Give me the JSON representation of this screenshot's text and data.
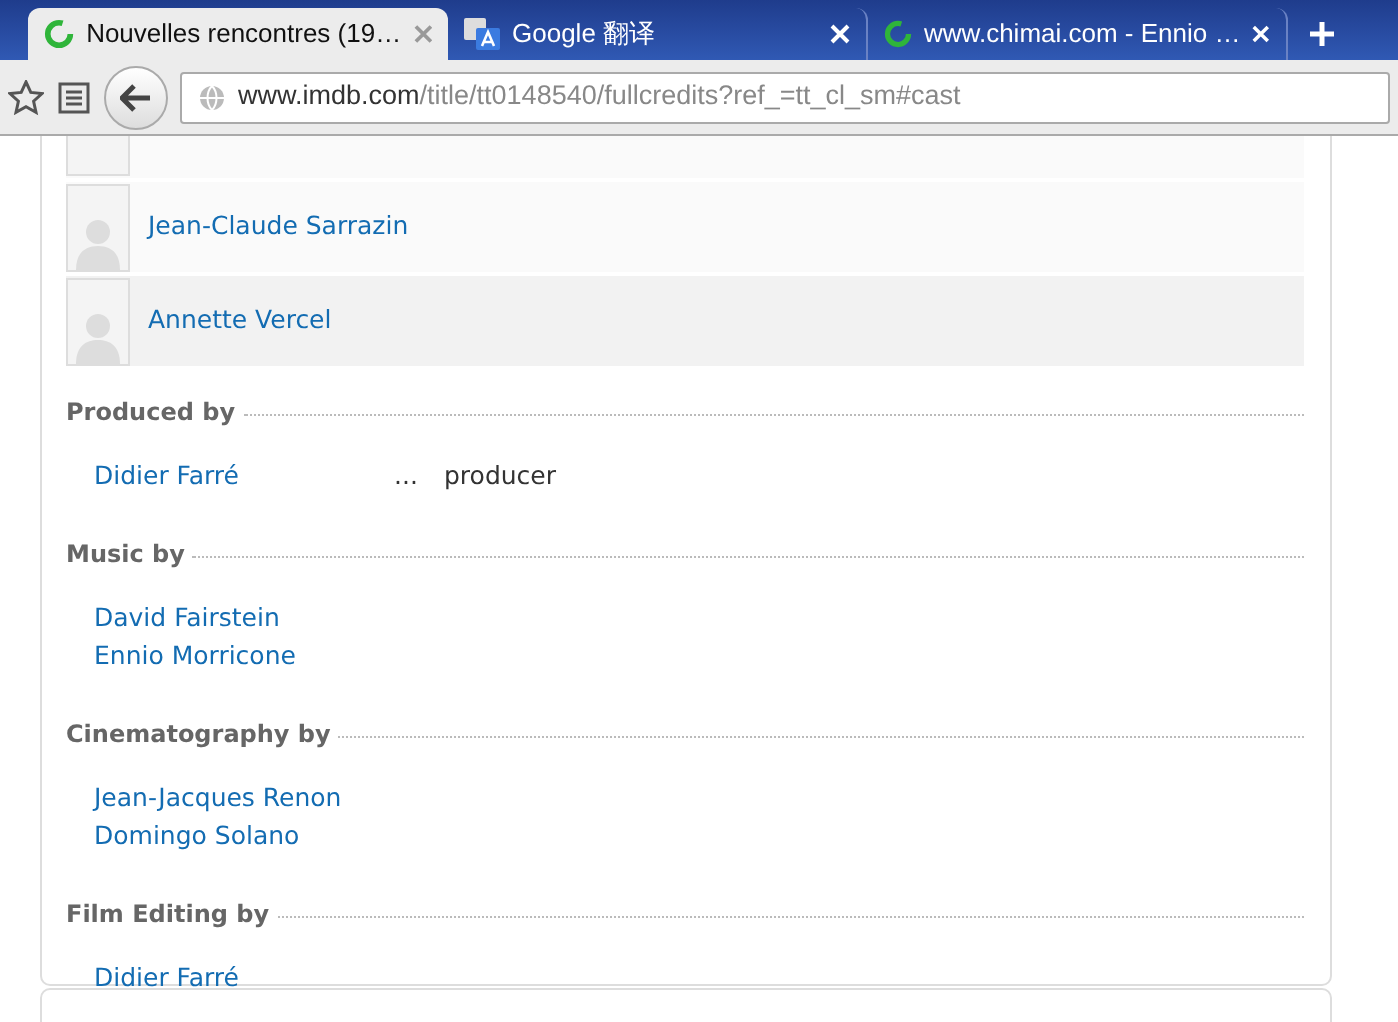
{
  "tabs": [
    {
      "title": "Nouvelles rencontres (19…",
      "selected": true,
      "kind": "loading"
    },
    {
      "title": "Google 翻译",
      "selected": false,
      "kind": "translate"
    },
    {
      "title": "www.chimai.com - Ennio …",
      "selected": false,
      "kind": "loading"
    }
  ],
  "address": {
    "host": "www.imdb.com",
    "path": "/title/tt0148540/fullcredits?ref_=tt_cl_sm#cast"
  },
  "cast": [
    {
      "name": "Jean-Claude Sarrazin"
    },
    {
      "name": "Annette Vercel"
    }
  ],
  "sections": [
    {
      "heading": "Produced by",
      "credits": [
        {
          "name": "Didier Farré",
          "separator": "...",
          "role": "producer"
        }
      ]
    },
    {
      "heading": "Music by",
      "credits": [
        {
          "name": "David Fairstein"
        },
        {
          "name": "Ennio Morricone"
        }
      ]
    },
    {
      "heading": "Cinematography by",
      "credits": [
        {
          "name": "Jean-Jacques Renon"
        },
        {
          "name": "Domingo Solano"
        }
      ]
    },
    {
      "heading": "Film Editing by",
      "credits": [
        {
          "name": "Didier Farré"
        }
      ]
    }
  ]
}
